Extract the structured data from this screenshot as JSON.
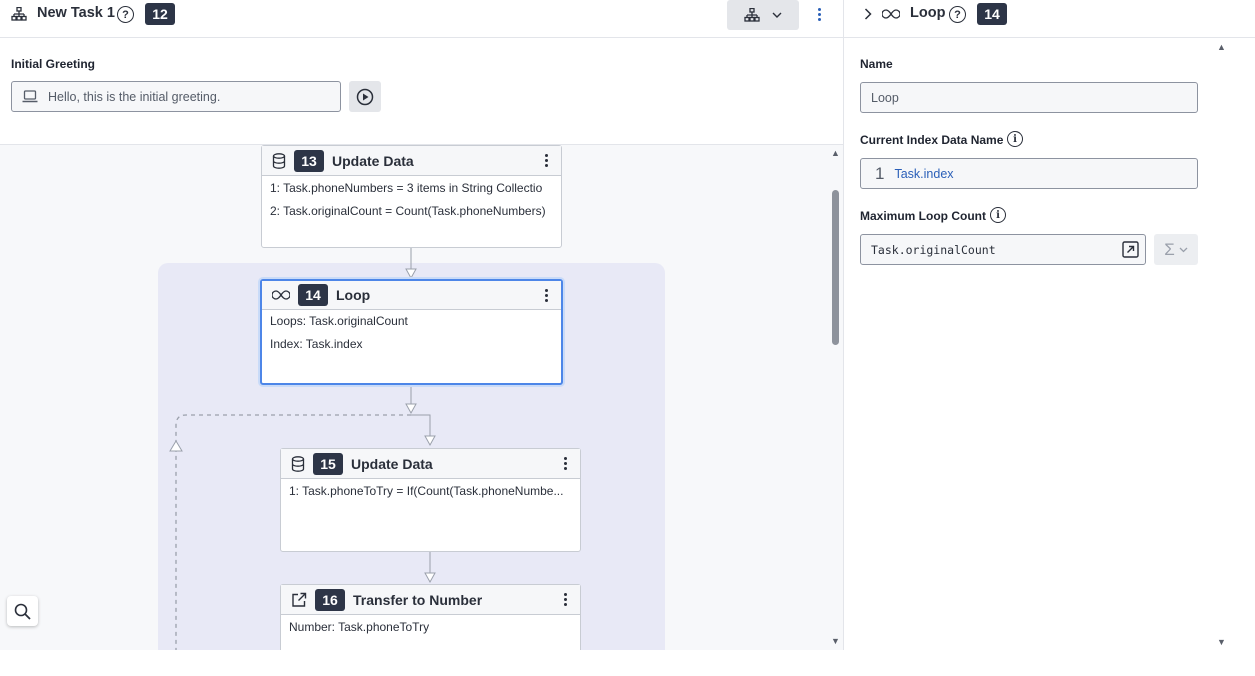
{
  "task": {
    "title": "New Task 1",
    "number": "12"
  },
  "greeting": {
    "label": "Initial Greeting",
    "value": "Hello, this is the initial greeting."
  },
  "nodes": {
    "n13": {
      "number": "13",
      "title": "Update Data",
      "lines": [
        "1: Task.phoneNumbers = 3 items in String Collectio",
        "2: Task.originalCount = Count(Task.phoneNumbers)"
      ]
    },
    "n14": {
      "number": "14",
      "title": "Loop",
      "lines": [
        "Loops: Task.originalCount",
        "Index: Task.index"
      ]
    },
    "n15": {
      "number": "15",
      "title": "Update Data",
      "lines": [
        "1: Task.phoneToTry = If(Count(Task.phoneNumbe..."
      ]
    },
    "n16": {
      "number": "16",
      "title": "Transfer to Number",
      "lines": [
        "Number: Task.phoneToTry"
      ]
    }
  },
  "panel": {
    "title": "Loop",
    "number": "14",
    "name_label": "Name",
    "name_value": "Loop",
    "index_label": "Current Index Data Name",
    "index_prefix": "1",
    "index_value": "Task.index",
    "max_label": "Maximum Loop Count",
    "max_value": "Task.originalCount"
  },
  "icons": {
    "flow": "sitemap-icon",
    "help": "help-circle-icon",
    "more": "more-vertical-icon",
    "database": "database-icon",
    "loop": "infinity-icon",
    "transfer": "external-link-icon",
    "play": "play-circle-icon",
    "laptop": "laptop-icon",
    "search": "search-icon",
    "info": "info-icon",
    "expand": "expand-icon",
    "sigma": "sigma-icon",
    "chevron": "chevron-icon"
  },
  "colors": {
    "badge": "#2d3547",
    "selection": "#4d86e8",
    "loop_bg": "#e8e9f6",
    "link": "#2a5fb8"
  }
}
